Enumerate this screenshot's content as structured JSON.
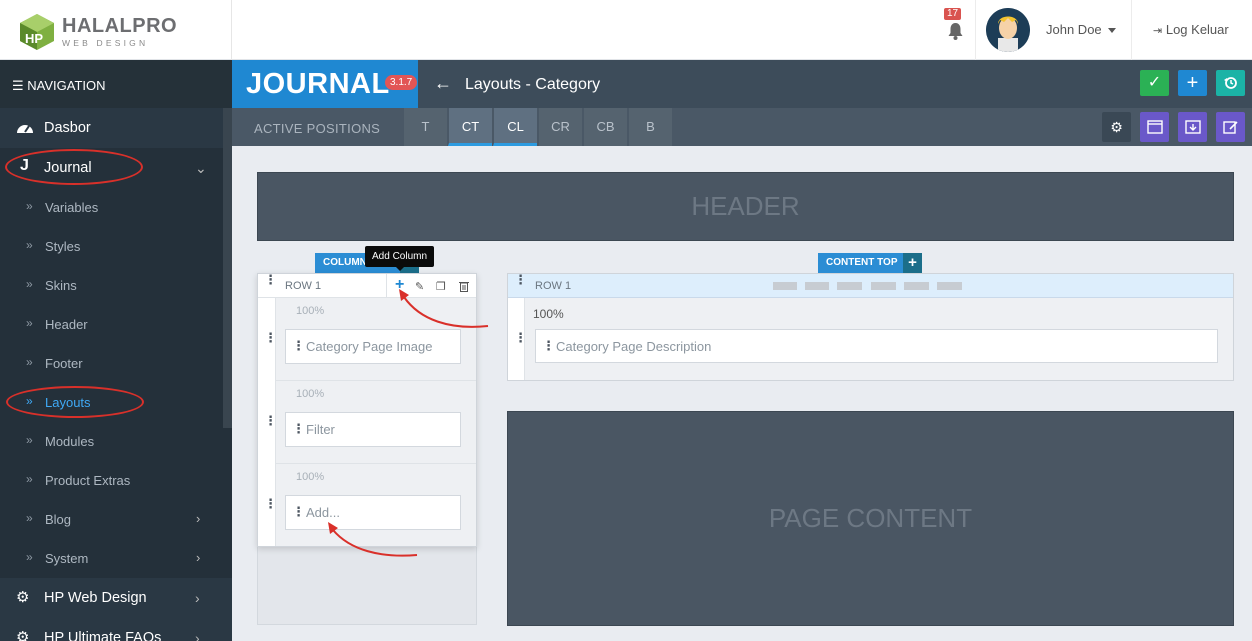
{
  "logo": {
    "name": "HALALPRO",
    "tagline": "WEB DESIGN"
  },
  "topbar": {
    "notification_count": "17",
    "user_name": "John Doe",
    "logout_label": "Log Keluar"
  },
  "sidebar": {
    "title": "NAVIGATION",
    "items": {
      "dasbor": "Dasbor",
      "journal": "Journal",
      "hp_web_design": "HP Web Design",
      "hp_ultimate_faqs": "HP Ultimate FAQs"
    },
    "sub_items": [
      "Variables",
      "Styles",
      "Skins",
      "Header",
      "Footer",
      "Layouts",
      "Modules",
      "Product Extras",
      "Blog",
      "System"
    ]
  },
  "journal_bar": {
    "logo": "JOURNAL",
    "version": "3.1.7",
    "title": "Layouts - Category"
  },
  "positions_bar": {
    "label": "ACTIVE POSITIONS",
    "tabs": [
      "T",
      "CT",
      "CL",
      "CR",
      "CB",
      "B"
    ]
  },
  "canvas": {
    "header": "HEADER",
    "page_content": "PAGE CONTENT",
    "column_left_label": "COLUMN LEFT",
    "content_top_label": "CONTENT TOP",
    "tooltip": "Add Column",
    "left_row_title": "ROW 1",
    "right_row_title": "ROW 1",
    "left_sections": [
      {
        "pct": "100%",
        "module": "Category Page Image"
      },
      {
        "pct": "100%",
        "module": "Filter"
      },
      {
        "pct": "100%",
        "module": "Add..."
      }
    ],
    "right_section": {
      "pct": "100%",
      "module": "Category Page Description"
    }
  },
  "colors": {
    "journal_blue": "#1f88d2",
    "sidebar_bg": "#2a3844",
    "annotation_red": "#d9302a",
    "save_green": "#2bb155"
  }
}
